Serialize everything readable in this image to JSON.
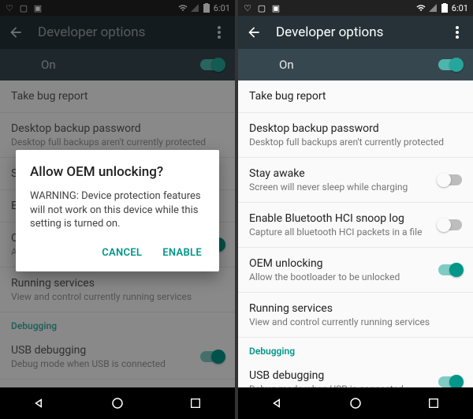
{
  "statusbar": {
    "time": "6:01"
  },
  "appbar": {
    "title": "Developer options"
  },
  "master": {
    "label": "On"
  },
  "left": {
    "items": [
      {
        "title": "Take bug report",
        "sub": ""
      },
      {
        "title": "Desktop backup password",
        "sub": "Desktop full backups aren't currently protected"
      },
      {
        "title": "S",
        "sub": ""
      },
      {
        "title": "E",
        "sub": ""
      },
      {
        "title": "OEM unlocking",
        "sub": "Allow the bootloader to be unlocked"
      },
      {
        "title": "Running services",
        "sub": "View and control currently running services"
      }
    ],
    "section": "Debugging",
    "usb": {
      "title": "USB debugging",
      "sub": "Debug mode when USB is connected"
    }
  },
  "right": {
    "items": [
      {
        "title": "Take bug report",
        "sub": ""
      },
      {
        "title": "Desktop backup password",
        "sub": "Desktop full backups aren't currently protected"
      },
      {
        "title": "Stay awake",
        "sub": "Screen will never sleep while charging"
      },
      {
        "title": "Enable Bluetooth HCI snoop log",
        "sub": "Capture all bluetooth HCI packets in a file"
      },
      {
        "title": "OEM unlocking",
        "sub": "Allow the bootloader to be unlocked"
      },
      {
        "title": "Running services",
        "sub": "View and control currently running services"
      }
    ],
    "section": "Debugging",
    "usb": {
      "title": "USB debugging",
      "sub": "Debug mode when USB is connected"
    }
  },
  "dialog": {
    "title": "Allow OEM unlocking?",
    "body": "WARNING: Device protection features will not work on this device while this setting is turned on.",
    "cancel": "CANCEL",
    "ok": "ENABLE"
  }
}
